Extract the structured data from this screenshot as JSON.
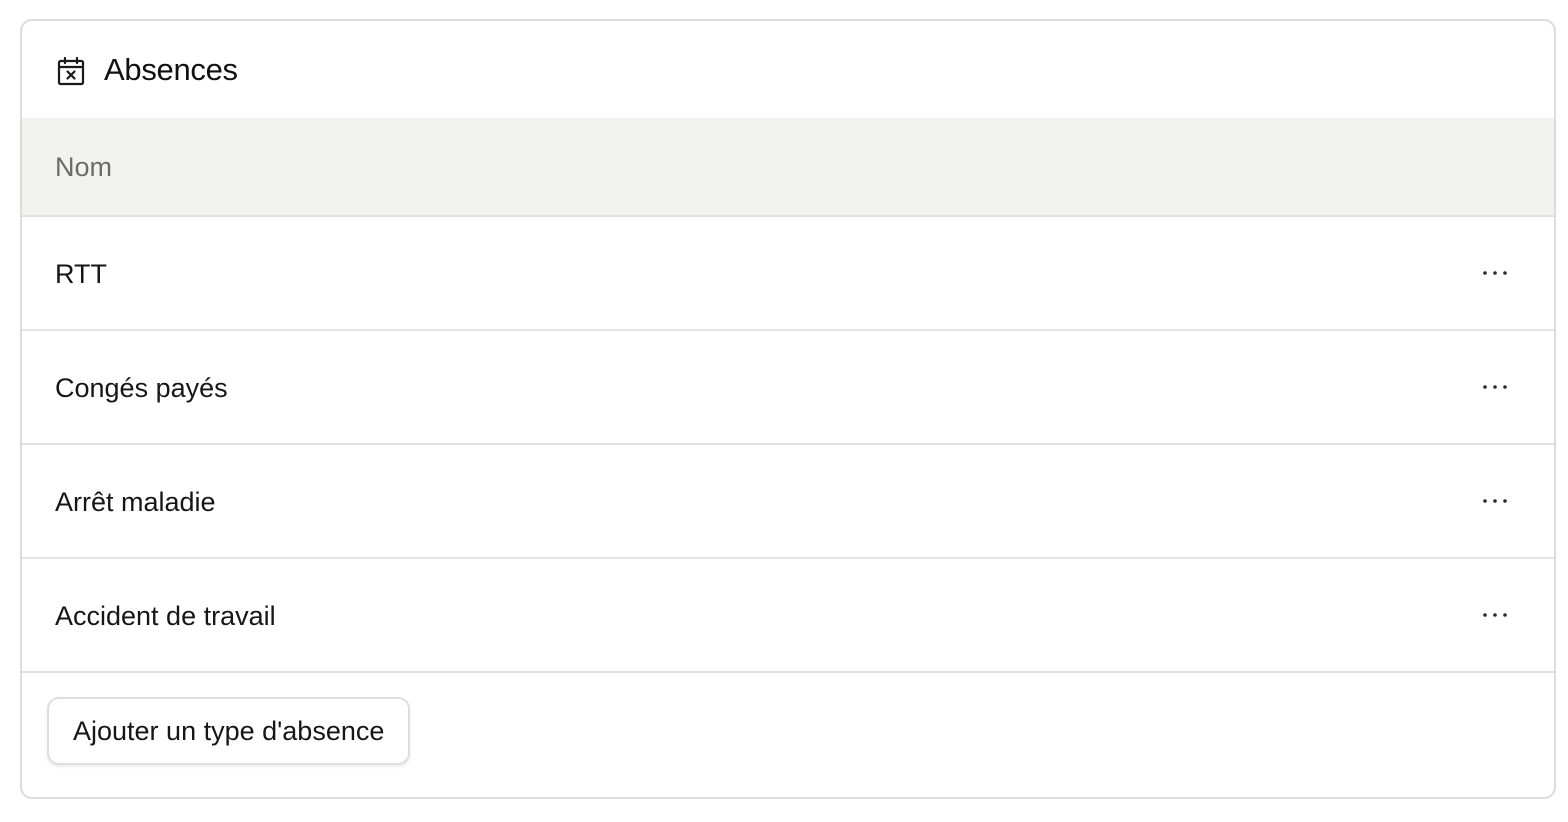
{
  "card": {
    "icon": "calendar-x-icon",
    "title": "Absences"
  },
  "table": {
    "columns": [
      "Nom"
    ],
    "rows": [
      {
        "name": "RTT",
        "actions_icon": "more-horizontal-icon"
      },
      {
        "name": "Congés payés",
        "actions_icon": "more-horizontal-icon"
      },
      {
        "name": "Arrêt maladie",
        "actions_icon": "more-horizontal-icon"
      },
      {
        "name": "Accident de travail",
        "actions_icon": "more-horizontal-icon"
      }
    ]
  },
  "footer": {
    "add_label": "Ajouter un type d'absence"
  },
  "colors": {
    "header_bg": "#f2f2f1",
    "border": "#dcdcdc",
    "text": "#161616",
    "muted_text": "#6b6b6b"
  }
}
